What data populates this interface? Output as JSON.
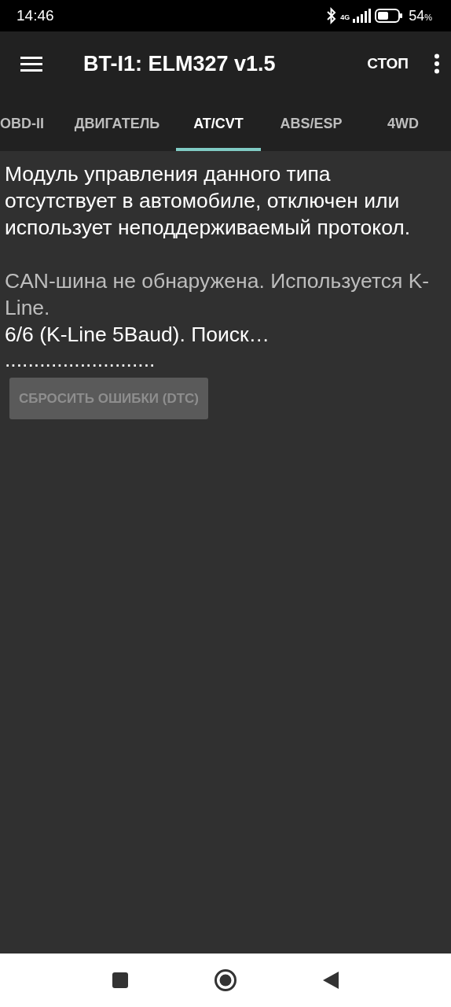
{
  "status_bar": {
    "time": "14:46",
    "network": "4G",
    "battery": "54",
    "battery_unit": "%"
  },
  "toolbar": {
    "title": "BT-I1: ELM327 v1.5",
    "action": "СТОП"
  },
  "tabs": [
    {
      "label": "OBD-II",
      "selected": false
    },
    {
      "label": "ДВИГАТЕЛЬ",
      "selected": false
    },
    {
      "label": "AT/CVT",
      "selected": true
    },
    {
      "label": "ABS/ESP",
      "selected": false
    },
    {
      "label": "4WD",
      "selected": false
    }
  ],
  "log": [
    {
      "kind": "message",
      "text": "Модуль управления данного типа отсутствует в автомобиле, отключен или использует неподдерживаемый протокол."
    },
    {
      "kind": "gap"
    },
    {
      "kind": "info",
      "text": "CAN-шина не обнаружена. Используется K-Line."
    },
    {
      "kind": "message",
      "text": "6/6 (K-Line 5Baud). Поиск…"
    },
    {
      "kind": "progress",
      "text": ".........................."
    }
  ],
  "reset_button": {
    "label": "СБРОСИТЬ ОШИБКИ (DTC)",
    "disabled": true
  }
}
